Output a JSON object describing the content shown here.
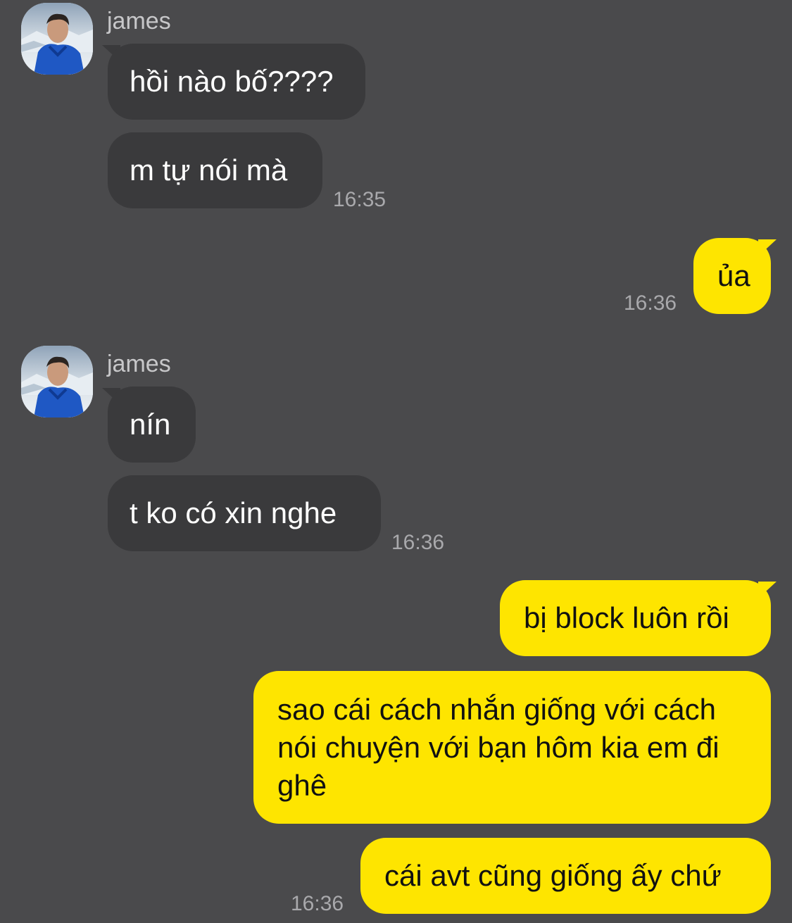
{
  "colors": {
    "background": "#4a4a4c",
    "incoming_bubble": "#3a3a3c",
    "outgoing_bubble": "#fee500",
    "timestamp": "#a9a9ac",
    "sender_name": "#c7c7c9"
  },
  "groups": [
    {
      "direction": "incoming",
      "sender": "james",
      "avatar": "profile-photo",
      "messages": [
        "hồi nào bố????",
        "m tự nói mà"
      ],
      "time": "16:35"
    },
    {
      "direction": "outgoing",
      "messages": [
        "ủa"
      ],
      "time": "16:36"
    },
    {
      "direction": "incoming",
      "sender": "james",
      "avatar": "profile-photo",
      "messages": [
        "nín",
        "t ko có xin nghe"
      ],
      "time": "16:36"
    },
    {
      "direction": "outgoing",
      "messages": [
        "bị block luôn rồi",
        "sao cái cách nhắn giống với cách nói chuyện với bạn hôm kia em đi ghê",
        "cái avt cũng giống ấy chứ"
      ],
      "time": "16:36"
    }
  ]
}
